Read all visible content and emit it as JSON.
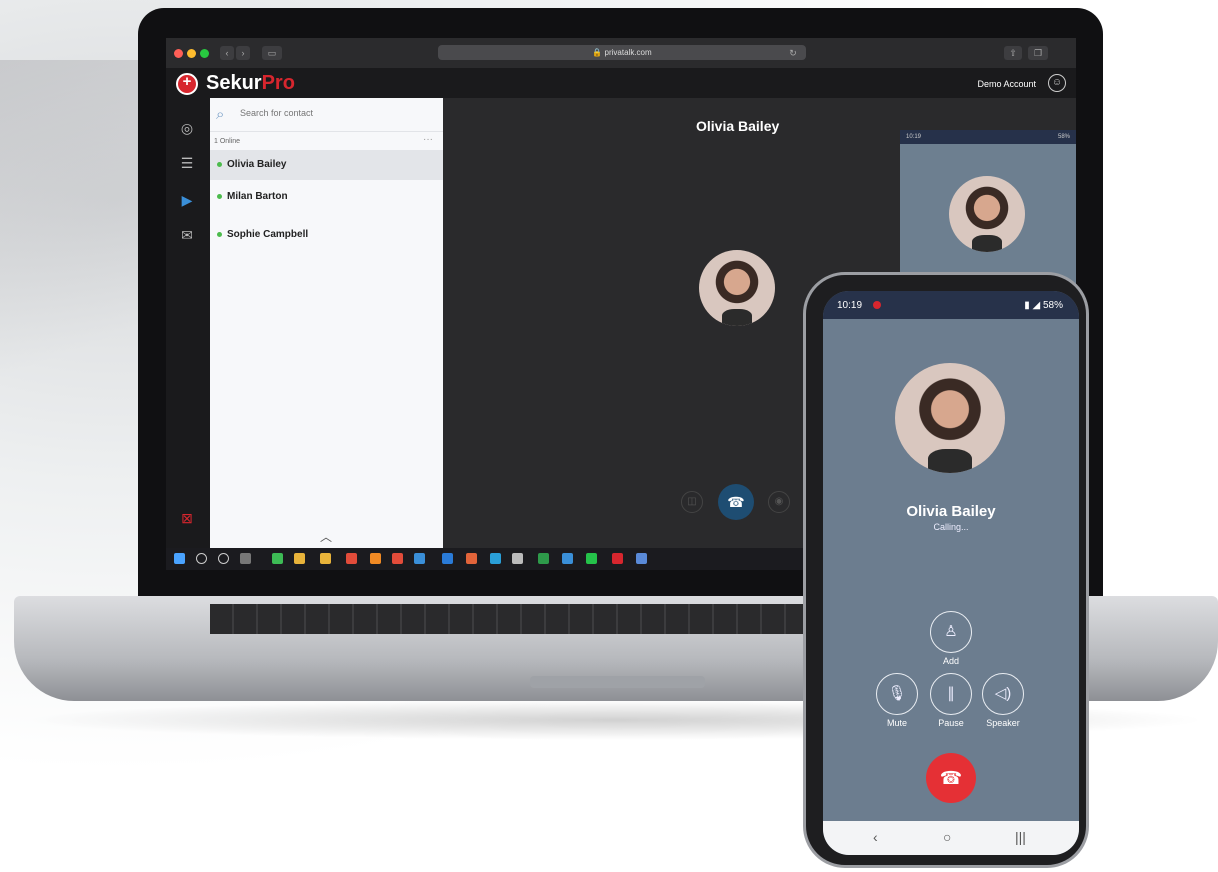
{
  "browser": {
    "url": "privatalk.com"
  },
  "app": {
    "brand_main": "Sekur",
    "brand_accent": "Pro",
    "account_label": "Demo Account",
    "accent_color": "#d7262e"
  },
  "sidebar_icons": [
    "contacts-icon",
    "chat-icon",
    "video-icon",
    "mail-icon"
  ],
  "contacts": {
    "search_placeholder": "Search for contact",
    "online_count": "1 Online",
    "items": [
      {
        "name": "Olivia Bailey",
        "selected": true
      },
      {
        "name": "Milan Barton",
        "selected": false
      },
      {
        "name": "Sophie Campbell",
        "selected": false
      }
    ]
  },
  "call": {
    "contact_name": "Olivia Bailey"
  },
  "remote_preview": {
    "time": "10:19",
    "battery": "58%"
  },
  "phone": {
    "time": "10:19",
    "battery": "58%",
    "contact_name": "Olivia Bailey",
    "status": "Calling...",
    "add_label": "Add",
    "mute_label": "Mute",
    "pause_label": "Pause",
    "speaker_label": "Speaker",
    "end_color": "#e53035"
  }
}
